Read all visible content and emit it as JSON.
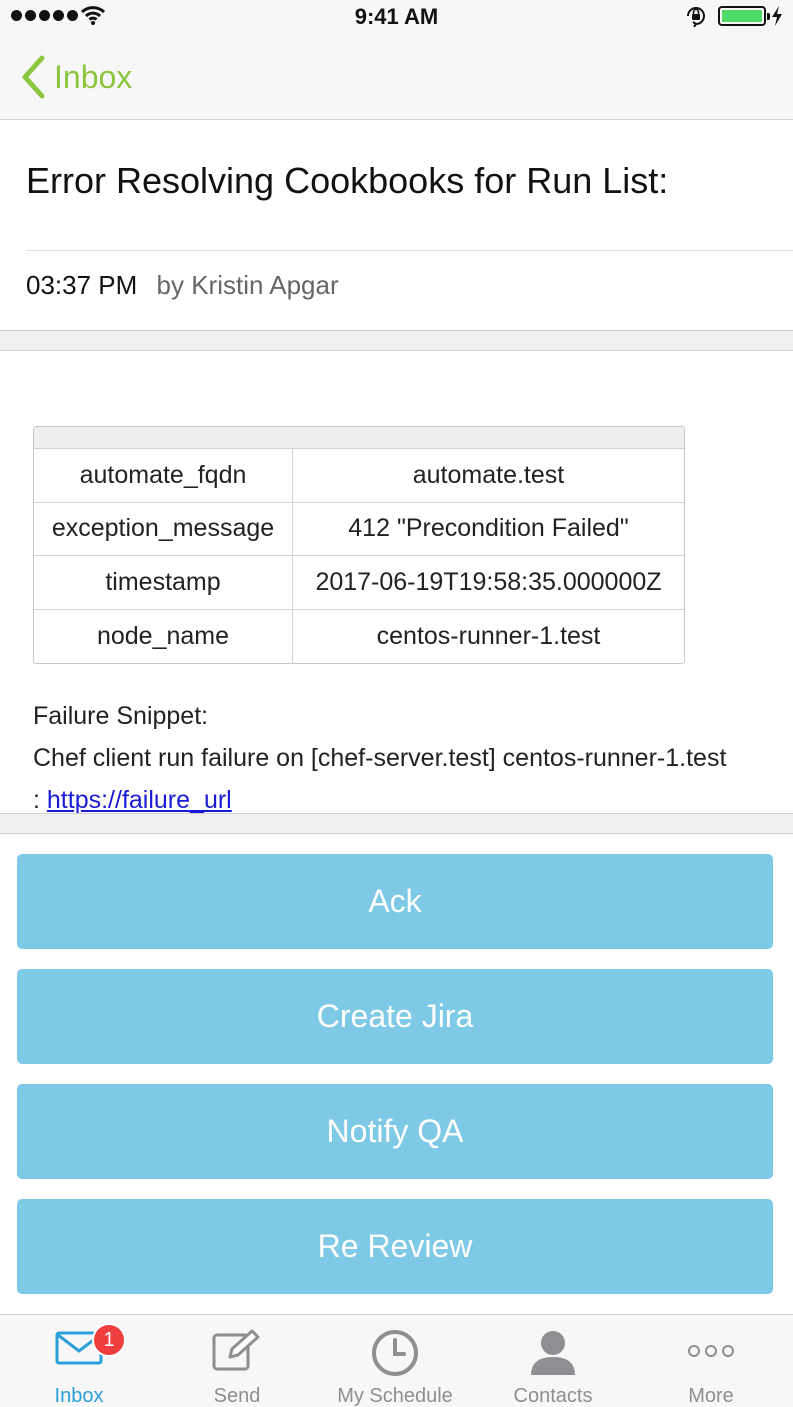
{
  "status_bar": {
    "time": "9:41 AM"
  },
  "nav": {
    "back_label": "Inbox"
  },
  "message": {
    "title": "Error Resolving Cookbooks for Run List:",
    "time": "03:37 PM",
    "author": "by Kristin Apgar"
  },
  "details": {
    "rows": [
      {
        "key": "automate_fqdn",
        "value": "automate.test"
      },
      {
        "key": "exception_message",
        "value": "412 \"Precondition Failed\""
      },
      {
        "key": "timestamp",
        "value": "2017-06-19T19:58:35.000000Z"
      },
      {
        "key": "node_name",
        "value": "centos-runner-1.test"
      }
    ]
  },
  "snippet": {
    "heading": "Failure Snippet:",
    "text": "Chef client run failure on [chef-server.test] centos-runner-1.test : ",
    "link": "https://failure_url"
  },
  "actions": {
    "ack": "Ack",
    "create_jira": "Create Jira",
    "notify_qa": "Notify QA",
    "re_review": "Re Review"
  },
  "colors": {
    "accent_green": "#8cc63f",
    "button_blue": "#7ecae6",
    "tab_active": "#2a9fd8",
    "badge_red": "#ef3e3e"
  },
  "tabs": {
    "inbox": {
      "label": "Inbox",
      "icon": "mail-icon",
      "badge": "1"
    },
    "send": {
      "label": "Send",
      "icon": "compose-icon"
    },
    "schedule": {
      "label": "My Schedule",
      "icon": "clock-icon"
    },
    "contacts": {
      "label": "Contacts",
      "icon": "person-icon"
    },
    "more": {
      "label": "More",
      "icon": "more-icon"
    }
  }
}
